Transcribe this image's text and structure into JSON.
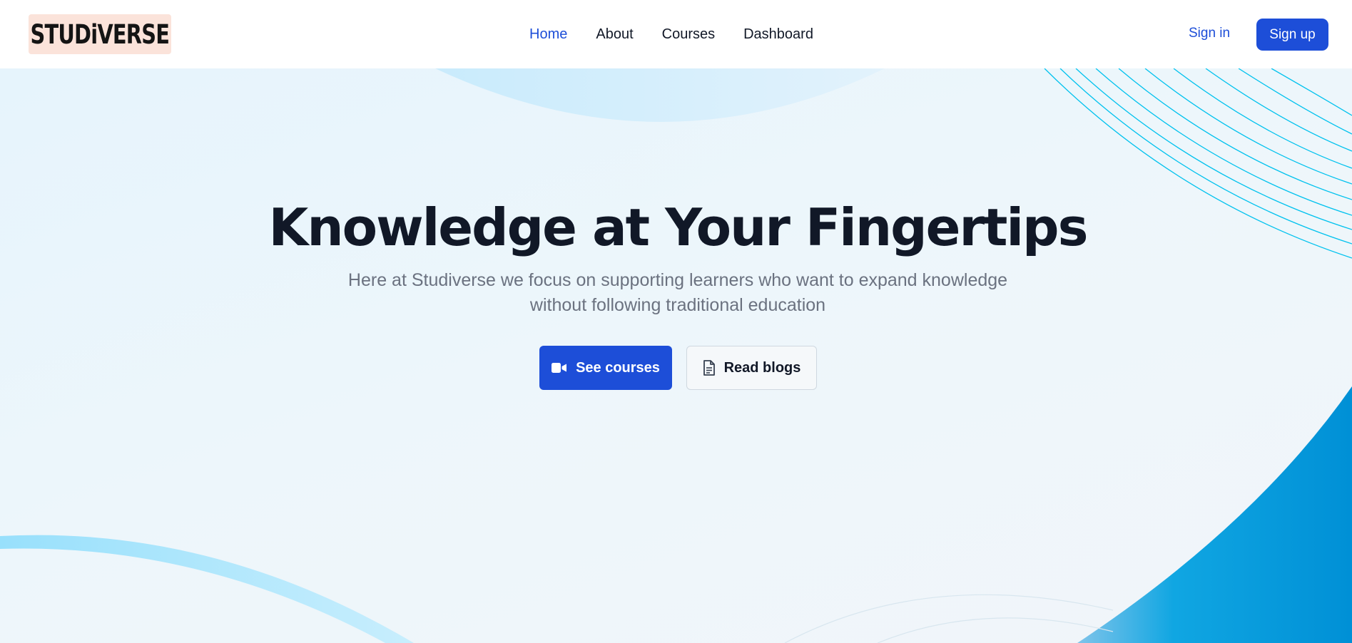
{
  "header": {
    "logo_text": "STUDiVERSE",
    "nav": [
      {
        "label": "Home",
        "active": true
      },
      {
        "label": "About",
        "active": false
      },
      {
        "label": "Courses",
        "active": false
      },
      {
        "label": "Dashboard",
        "active": false
      }
    ],
    "sign_in_label": "Sign in",
    "sign_up_label": "Sign up"
  },
  "hero": {
    "title": "Knowledge at Your Fingertips",
    "subtitle": "Here at Studiverse we focus on supporting learners who want to expand knowledge without following traditional education",
    "primary_button": {
      "label": "See courses",
      "icon": "video-camera-icon"
    },
    "secondary_button": {
      "label": "Read blogs",
      "icon": "document-icon"
    }
  },
  "colors": {
    "accent": "#1d4ed8",
    "logo_bg": "#fbe3da",
    "heading": "#111827",
    "muted_text": "#6b7280",
    "decor_blue": "#0096db",
    "decor_cyan": "#00c2ee"
  }
}
